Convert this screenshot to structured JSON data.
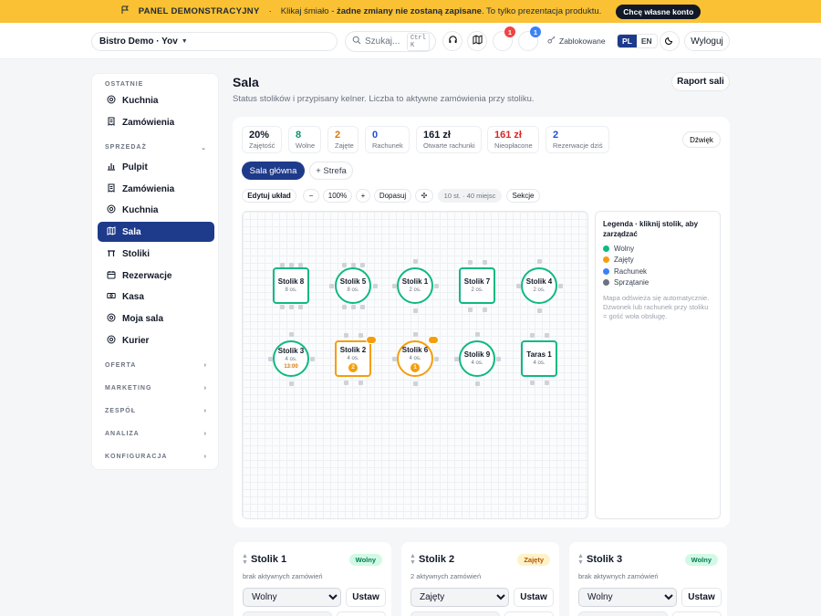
{
  "banner": {
    "tag": "PANEL DEMONSTRACYJNY",
    "sep": "·",
    "text_pre": "Klikaj śmiało - ",
    "text_bold": "żadne zmiany nie zostaną zapisane",
    "text_post": ". To tylko prezentacja produktu.",
    "cta": "Chcę własne konto",
    "bg": "#f9c133"
  },
  "header": {
    "org": "Bistro Demo · Yov",
    "search_placeholder": "Szukaj...",
    "search_kbd": "Ctrl K",
    "notif_badge_1": "1",
    "notif_badge_2": "1",
    "blocked": "Zablokowane",
    "lang_active": "PL",
    "lang_other": "EN",
    "logout": "Wyloguj"
  },
  "sidebar": {
    "section_recent": "OSTATNIE",
    "recent": [
      "Kuchnia",
      "Zamówienia"
    ],
    "section_sales": "SPRZEDAŻ",
    "sales": [
      "Pulpit",
      "Zamówienia",
      "Kuchnia",
      "Sala",
      "Stoliki",
      "Rezerwacje",
      "Kasa",
      "Moja sala",
      "Kurier"
    ],
    "active": "Sala",
    "groups": [
      "OFERTA",
      "MARKETING",
      "ZESPÓŁ",
      "ANALIZA",
      "KONFIGURACJA"
    ]
  },
  "page": {
    "title": "Sala",
    "subtitle": "Status stolików i przypisany kelner. Liczba to aktywne zamówienia przy stoliku.",
    "report_button": "Raport sali"
  },
  "stats": [
    {
      "value": "20%",
      "label": "Zajętość",
      "color": "#111827"
    },
    {
      "value": "8",
      "label": "Wolne",
      "color": "#059669"
    },
    {
      "value": "2",
      "label": "Zajęte",
      "color": "#d97706"
    },
    {
      "value": "0",
      "label": "Rachunek",
      "color": "#1d4ed8"
    },
    {
      "value": "161 zł",
      "label": "Otwarte rachunki",
      "color": "#111827"
    },
    {
      "value": "161 zł",
      "label": "Nieopłacone",
      "color": "#dc2626"
    },
    {
      "value": "2",
      "label": "Rezerwacje dziś",
      "color": "#1d4ed8"
    }
  ],
  "sound_button": "Dźwięk",
  "zones": {
    "active": "Sala główna",
    "add": "+ Strefa"
  },
  "toolbar": {
    "edit": "Edytuj układ",
    "minus": "−",
    "zoom": "100%",
    "plus": "+",
    "fit": "Dopasuj",
    "move": "✣",
    "info": "10 st. · 40 miejsc",
    "sections": "Sekcje"
  },
  "legend": {
    "title": "Legenda · kliknij stolik, aby zarządzać",
    "items": [
      {
        "label": "Wolny",
        "color": "#10b981"
      },
      {
        "label": "Zajęty",
        "color": "#f59e0b"
      },
      {
        "label": "Rachunek",
        "color": "#3b82f6"
      },
      {
        "label": "Sprzątanie",
        "color": "#6b7280"
      }
    ],
    "note": "Mapa odświeża się automatycznie. Dzwonek lub rachunek przy stoliku = gość woła obsługę."
  },
  "tables": [
    {
      "name": "Stolik 8",
      "seats": "8 os.",
      "shape": "rect",
      "status": "free"
    },
    {
      "name": "Stolik 5",
      "seats": "8 os.",
      "shape": "round",
      "status": "free"
    },
    {
      "name": "Stolik 1",
      "seats": "2 os.",
      "shape": "round",
      "status": "free"
    },
    {
      "name": "Stolik 7",
      "seats": "2 os.",
      "shape": "rect",
      "status": "free"
    },
    {
      "name": "Stolik 4",
      "seats": "2 os.",
      "shape": "round",
      "status": "free"
    },
    {
      "name": "Stolik 3",
      "seats": "4 os.",
      "shape": "round",
      "status": "free",
      "time": "13:00"
    },
    {
      "name": "Stolik 2",
      "seats": "4 os.",
      "shape": "rect",
      "status": "busy",
      "count": "2"
    },
    {
      "name": "Stolik 6",
      "seats": "4 os.",
      "shape": "round",
      "status": "busy",
      "count": "1"
    },
    {
      "name": "Stolik 9",
      "seats": "4 os.",
      "shape": "round",
      "status": "free"
    },
    {
      "name": "Taras 1",
      "seats": "4 os.",
      "shape": "rect",
      "status": "free"
    }
  ],
  "status_colors": {
    "free": "#10b981",
    "busy": "#f59e0b"
  },
  "cards": [
    {
      "title": "Stolik 1",
      "status": "Wolny",
      "sub": "brak aktywnych zamówień",
      "select": "Wolny",
      "button": "Ustaw",
      "pill_bg": "#d1fae5",
      "pill_fg": "#047857"
    },
    {
      "title": "Stolik 2",
      "status": "Zajęty",
      "sub": "2 aktywnych zamówień",
      "select": "Zajęty",
      "button": "Ustaw",
      "pill_bg": "#fef3c7",
      "pill_fg": "#b45309"
    },
    {
      "title": "Stolik 3",
      "status": "Wolny",
      "sub": "brak aktywnych zamówień",
      "select": "Wolny",
      "button": "Ustaw",
      "pill_bg": "#d1fae5",
      "pill_fg": "#047857"
    }
  ],
  "select_options": [
    "Wolny",
    "Zajęty",
    "Rachunek",
    "Sprzątanie"
  ]
}
